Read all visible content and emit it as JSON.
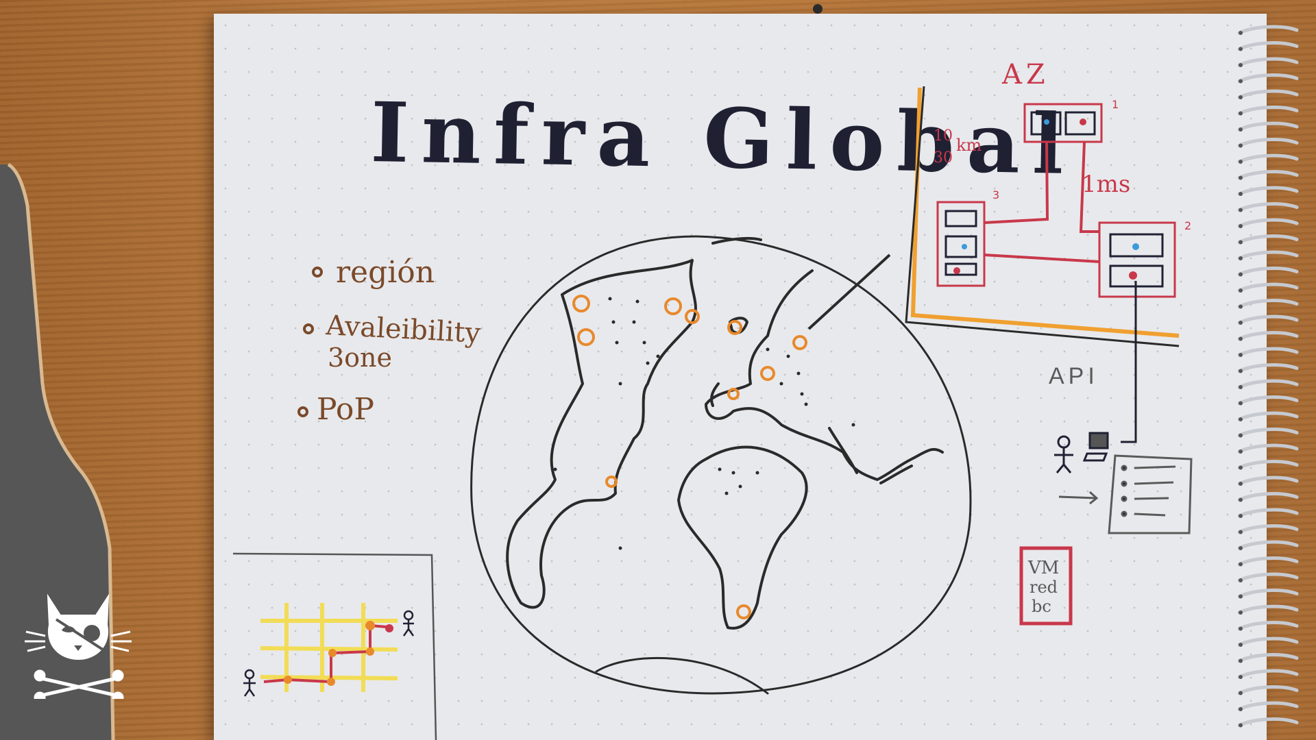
{
  "title": "Infra Global",
  "legend": {
    "items": [
      {
        "label": "región"
      },
      {
        "label": "Avaleibility"
      },
      {
        "label": "3one"
      },
      {
        "label": "PoP"
      }
    ]
  },
  "az_diagram": {
    "label": "AZ",
    "distance_top": "10",
    "distance_bottom": "30",
    "distance_unit": "km",
    "latency": "1ms",
    "node_1": "1",
    "node_2": "2",
    "node_3": "3"
  },
  "api_label": "API",
  "stack_box": {
    "line1": "VM",
    "line2": "red",
    "line3": "bc"
  },
  "colors": {
    "ink": "#1f2133",
    "orange": "#e8892c",
    "red": "#c8384a",
    "brown": "#7a4a2a",
    "yellow": "#f2dc55"
  }
}
